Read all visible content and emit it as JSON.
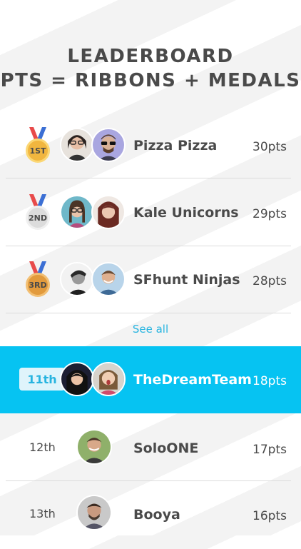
{
  "header": {
    "title_line1": "LEADERBOARD",
    "title_line2": "PTS = RIBBONS + MEDALS"
  },
  "top_teams": [
    {
      "medal": "1ST",
      "name": "Pizza Pizza",
      "points": "30pts"
    },
    {
      "medal": "2ND",
      "name": "Kale Unicorns",
      "points": "29pts"
    },
    {
      "medal": "3RD",
      "name": "SFhunt Ninjas",
      "points": "28pts"
    }
  ],
  "see_all_label": "See all",
  "current_team": {
    "rank": "11th",
    "name": "TheDreamTeam",
    "points": "18pts"
  },
  "other_teams": [
    {
      "rank": "12th",
      "name": "SoloONE",
      "points": "17pts"
    },
    {
      "rank": "13th",
      "name": "Booya",
      "points": "16pts"
    }
  ],
  "colors": {
    "accent": "#06c3f2",
    "link": "#27b4e0",
    "text": "#4a4a4a",
    "gold": "#f1b63f",
    "silver": "#dcdcdc",
    "bronze": "#e29a3c"
  }
}
